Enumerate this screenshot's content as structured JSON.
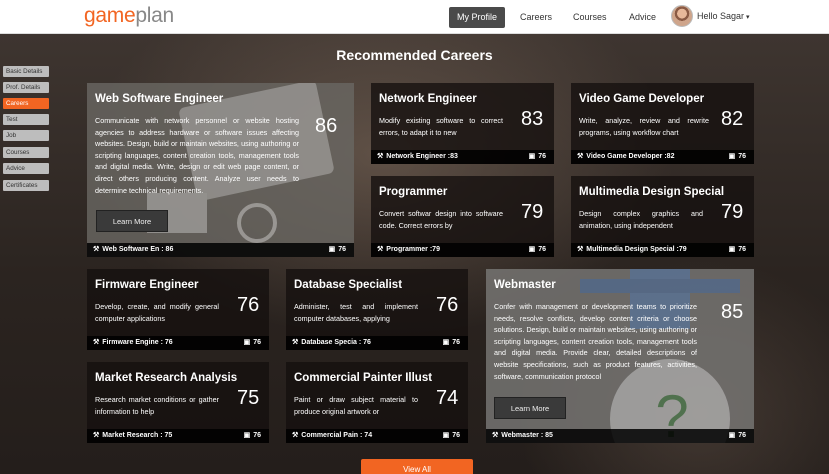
{
  "brand": {
    "logo_orange": "game",
    "logo_grey": "plan"
  },
  "nav": {
    "my_profile": "My Profile",
    "careers": "Careers",
    "courses": "Courses",
    "advice": "Advice",
    "user": "Hello Sagar"
  },
  "sidebar": {
    "items": [
      {
        "label": "Basic Details"
      },
      {
        "label": "Prof. Details"
      },
      {
        "label": "Careers"
      },
      {
        "label": "Test"
      },
      {
        "label": "Job"
      },
      {
        "label": "Courses"
      },
      {
        "label": "Advice"
      },
      {
        "label": "Certificates"
      }
    ],
    "active": "Careers"
  },
  "heading": "Recommended Careers",
  "cards": [
    {
      "title": "Web Software Engineer",
      "desc": "Communicate with network personnel or website hosting agencies to address hardware or software issues affecting websites. Design, build or maintain websites, using authoring or scripting languages, content creation tools, management tools and digital media. Write, design or edit web page content, or direct others producing content. Analyze user needs to determine technical requirements.",
      "score": "86",
      "foot": "Web Software En : 86",
      "jobs": "76",
      "button": "Learn More"
    },
    {
      "title": "Network Engineer",
      "desc": "Modify existing software to correct errors, to adapt it to new",
      "score": "83",
      "foot": "Network Engineer :83",
      "jobs": "76"
    },
    {
      "title": "Video Game Developer",
      "desc": "Write, analyze, review and rewrite programs, using workflow chart",
      "score": "82",
      "foot": "Video Game Developer :82",
      "jobs": "76"
    },
    {
      "title": "Programmer",
      "desc": "Convert softwar design into software code. Correct errors by",
      "score": "79",
      "foot": "Programmer :79",
      "jobs": "76"
    },
    {
      "title": "Multimedia Design Special",
      "desc": "Design complex graphics and animation, using independent",
      "score": "79",
      "foot": "Multimedia Design Special :79",
      "jobs": "76"
    },
    {
      "title": "Firmware Engineer",
      "desc": "Develop, create, and modify general computer applications",
      "score": "76",
      "foot": "Firmware Engine : 76",
      "jobs": "76"
    },
    {
      "title": "Database Specialist",
      "desc": "Administer, test and implement computer databases, applying",
      "score": "76",
      "foot": "Database Specia : 76",
      "jobs": "76"
    },
    {
      "title": "Webmaster",
      "desc": "Confer with management or development teams to prioritize needs, resolve conflicts, develop content criteria or choose solutions. Design, build or maintain websites, using authoring or scripting languages, content creation tools, management tools and digital media. Provide clear, detailed descriptions of website specifications, such as product features, activities, software, communication protocol",
      "score": "85",
      "foot": "Webmaster : 85",
      "jobs": "76",
      "button": "Learn More"
    },
    {
      "title": "Market Research Analysis",
      "desc": "Research market conditions or gather information to help",
      "score": "75",
      "foot": "Market Research : 75",
      "jobs": "76"
    },
    {
      "title": "Commercial Painter Illust",
      "desc": "Paint or draw subject material to produce original artwork or",
      "score": "74",
      "foot": "Commercial Pain : 74",
      "jobs": "76"
    }
  ],
  "view_all": "View All",
  "colors": {
    "accent": "#f26522",
    "card_dark": "#14100e",
    "card_light": "#787674"
  },
  "icons": {
    "wand": "magic-wand-icon",
    "case": "briefcase-icon",
    "caret": "caret-down-icon"
  }
}
